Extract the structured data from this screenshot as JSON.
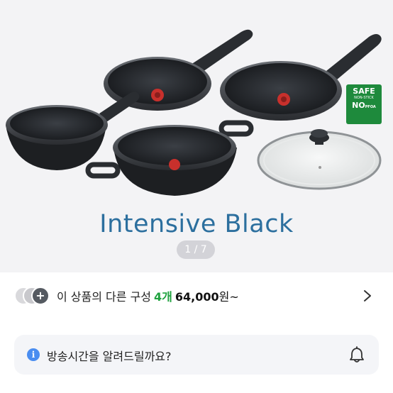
{
  "hero": {
    "title": "Intensive Black",
    "pager": "1 / 7",
    "badge": {
      "line1": "SAFE",
      "line2": "NON-STICK",
      "line3": "NO",
      "line3_small": "PFOA",
      "line4": "",
      "color": "#1e8a3c"
    }
  },
  "variants": {
    "label": "이 상품의 다른 구성",
    "count": "4개",
    "price": "64,000",
    "won": "원~",
    "more_icon": "chevron-right-icon",
    "add_icon": "plus-icon",
    "accent": "#1fa23f"
  },
  "notify": {
    "label": "방송시간을 알려드릴까요?",
    "info_icon": "i",
    "bell_icon": "bell-icon"
  }
}
